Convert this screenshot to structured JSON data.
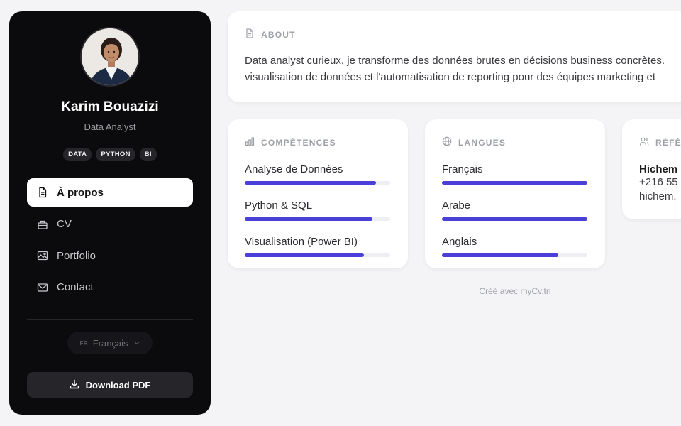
{
  "profile": {
    "name": "Karim Bouazizi",
    "role": "Data Analyst",
    "tags": [
      "DATA",
      "PYTHON",
      "BI"
    ]
  },
  "nav": {
    "items": [
      {
        "label": "À propos",
        "icon": "file-icon",
        "active": true
      },
      {
        "label": "CV",
        "icon": "briefcase-icon",
        "active": false
      },
      {
        "label": "Portfolio",
        "icon": "image-icon",
        "active": false
      },
      {
        "label": "Contact",
        "icon": "mail-icon",
        "active": false
      }
    ]
  },
  "language_select": {
    "code": "FR",
    "label": "Français"
  },
  "download": {
    "label": "Download PDF"
  },
  "about": {
    "title": "ABOUT",
    "line1": "Data analyst curieux, je transforme des données brutes en décisions business concrètes.",
    "line2": "visualisation de données et l'automatisation de reporting pour des équipes marketing et"
  },
  "skills": {
    "title": "COMPÉTENCES",
    "items": [
      {
        "label": "Analyse de Données",
        "level": 0.9
      },
      {
        "label": "Python & SQL",
        "level": 0.88
      },
      {
        "label": "Visualisation (Power BI)",
        "level": 0.82
      }
    ]
  },
  "languages": {
    "title": "LANGUES",
    "items": [
      {
        "label": "Français",
        "level": 1.0
      },
      {
        "label": "Arabe",
        "level": 1.0
      },
      {
        "label": "Anglais",
        "level": 0.8
      }
    ]
  },
  "references": {
    "title": "RÉFÉRENCES",
    "name": "Hichem",
    "phone": "+216 55",
    "email": "hichem."
  },
  "footer": {
    "text": "Créé avec myCv.tn"
  },
  "colors": {
    "accent": "#4a3fd6",
    "sidebar": "#0b0b0d",
    "background": "#f4f4f6"
  }
}
